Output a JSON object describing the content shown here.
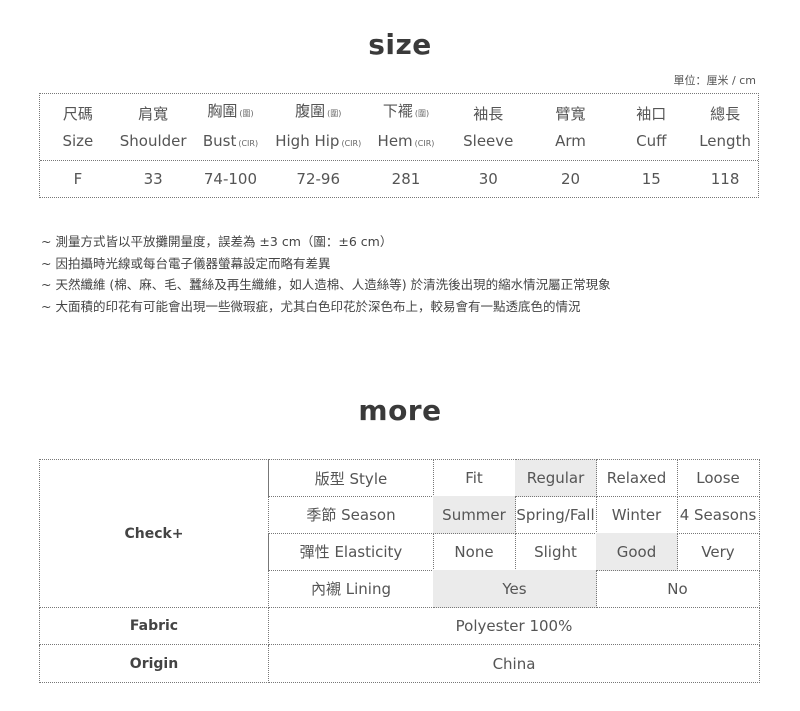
{
  "size_section": {
    "title": "size",
    "unit_note": "單位：厘米 / cm",
    "columns": [
      {
        "zh": "尺碼",
        "zh_sub": "",
        "en": "Size",
        "en_sub": ""
      },
      {
        "zh": "肩寬",
        "zh_sub": "",
        "en": "Shoulder",
        "en_sub": ""
      },
      {
        "zh": "胸圍",
        "zh_sub": "(圍)",
        "en": "Bust",
        "en_sub": "(CIR)"
      },
      {
        "zh": "腹圍",
        "zh_sub": "(圍)",
        "en": "High Hip",
        "en_sub": "(CIR)"
      },
      {
        "zh": "下襬",
        "zh_sub": "(圍)",
        "en": "Hem",
        "en_sub": "(CIR)"
      },
      {
        "zh": "袖長",
        "zh_sub": "",
        "en": "Sleeve",
        "en_sub": ""
      },
      {
        "zh": "臂寬",
        "zh_sub": "",
        "en": "Arm",
        "en_sub": ""
      },
      {
        "zh": "袖口",
        "zh_sub": "",
        "en": "Cuff",
        "en_sub": ""
      },
      {
        "zh": "總長",
        "zh_sub": "",
        "en": "Length",
        "en_sub": ""
      }
    ],
    "rows": [
      [
        "F",
        "33",
        "74-100",
        "72-96",
        "281",
        "30",
        "20",
        "15",
        "118"
      ]
    ],
    "notes": [
      "~ 測量方式皆以平放攤開量度，誤差為 ±3 cm（圍：±6 cm）",
      "~ 因拍攝時光線或每台電子儀器螢幕設定而略有差異",
      "~ 天然纖維 (棉、麻、毛、蠶絲及再生纖維，如人造棉、人造絲等) 於清洗後出現的縮水情況屬正常現象",
      "~ 大面積的印花有可能會出現一些微瑕疵，尤其白色印花於深色布上，較易會有一點透底色的情況"
    ]
  },
  "more_section": {
    "title": "more",
    "check_label": "Check+",
    "check_rows": [
      {
        "label": "版型 Style",
        "options": [
          "Fit",
          "Regular",
          "Relaxed",
          "Loose"
        ],
        "selected": "Regular"
      },
      {
        "label": "季節 Season",
        "options": [
          "Summer",
          "Spring/Fall",
          "Winter",
          "4 Seasons"
        ],
        "selected": "Summer"
      },
      {
        "label": "彈性 Elasticity",
        "options": [
          "None",
          "Slight",
          "Good",
          "Very"
        ],
        "selected": "Good"
      },
      {
        "label": "內襯 Lining",
        "options": [
          "Yes",
          "No"
        ],
        "selected": "Yes"
      }
    ],
    "fabric": {
      "label": "Fabric",
      "value": "Polyester 100%"
    },
    "origin": {
      "label": "Origin",
      "value": "China"
    },
    "highlight_color": "#ebebeb"
  }
}
